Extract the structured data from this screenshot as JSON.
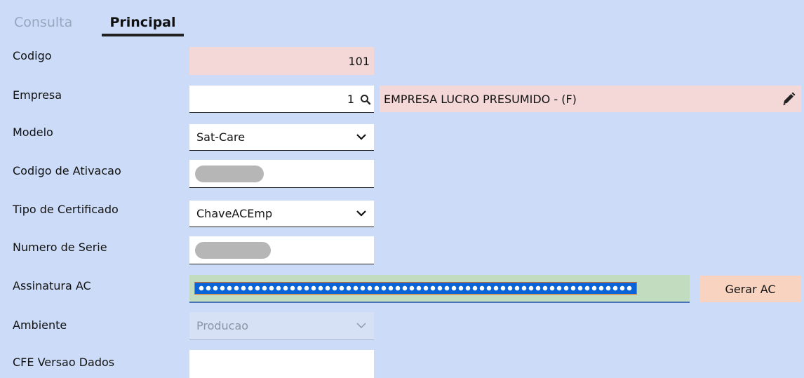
{
  "tabs": [
    {
      "label": "Consulta",
      "active": false
    },
    {
      "label": "Principal",
      "active": true
    }
  ],
  "form": {
    "codigo": {
      "label": "Codigo",
      "value": "101"
    },
    "empresa": {
      "label": "Empresa",
      "value": "1",
      "name": "EMPRESA LUCRO PRESUMIDO - (F)"
    },
    "modelo": {
      "label": "Modelo",
      "value": "Sat-Care"
    },
    "codigo_ativacao": {
      "label": "Codigo de Ativacao",
      "value": "(blurred)"
    },
    "tipo_certificado": {
      "label": "Tipo de Certificado",
      "value": "ChaveACEmp"
    },
    "numero_serie": {
      "label": "Numero de Serie",
      "value": "(blurred)"
    },
    "assinatura_ac": {
      "label": "Assinatura AC",
      "value": "(masked, selected)"
    },
    "ambiente": {
      "label": "Ambiente",
      "value": "Producao",
      "disabled": true
    },
    "cfe_versao_dados": {
      "label": "CFE Versao Dados",
      "value": ""
    }
  },
  "buttons": {
    "gerar_ac": "Gerar AC"
  },
  "icons": {
    "search": "search-icon",
    "edit": "pencil-icon",
    "dropdown": "chevron-down-icon"
  },
  "colors": {
    "background": "#ccdcf8",
    "readonly_field": "#f4d8d8",
    "signature_field": "#c2dcc0",
    "selection": "#0a64d8",
    "button": "#f8d3c0"
  }
}
